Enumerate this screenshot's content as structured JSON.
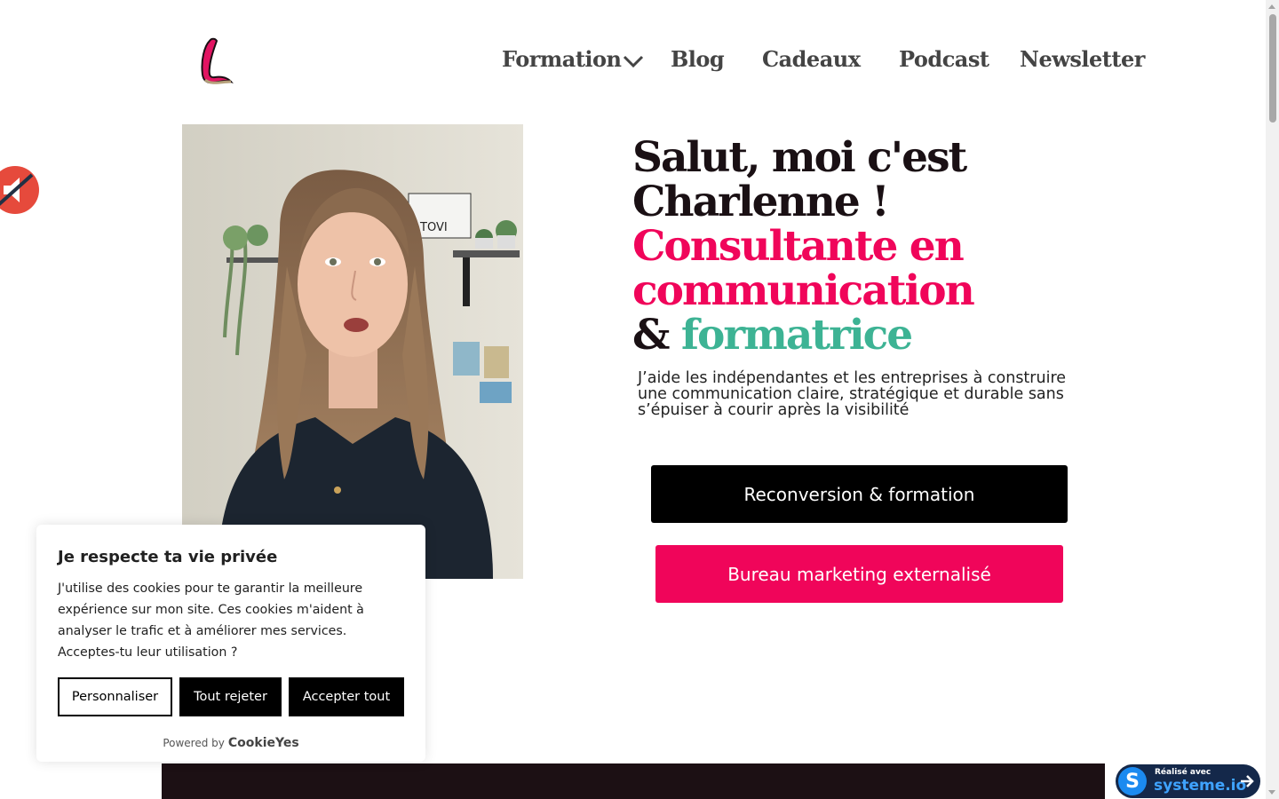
{
  "header": {
    "logo_icon": "script-letter-l-logo",
    "nav": [
      {
        "label": "Formation",
        "has_dropdown": true
      },
      {
        "label": "Blog"
      },
      {
        "label": "Cadeaux"
      },
      {
        "label": "Podcast"
      },
      {
        "label": "Newsletter"
      }
    ]
  },
  "hero": {
    "line1": "Salut, moi c'est",
    "line2": "Charlenne !",
    "line3": "Consultante en",
    "line4": "communication",
    "amp": "&",
    "highlight": "formatrice",
    "subtitle": "J’aide les indépendantes et les entreprises à construire une communication claire, stratégique et durable sans s’épuiser à courir après la visibilité",
    "btn_primary": "Reconversion & formation",
    "btn_secondary": "Bureau marketing externalisé",
    "video_icon": "muted-speaker-icon"
  },
  "cookie": {
    "title": "Je respecte ta vie privée",
    "text": "J'utilise des cookies pour te garantir la meilleure expérience sur mon site. Ces cookies m'aident à analyser le trafic et à améliorer mes services. Acceptes-tu leur utilisation ?",
    "btn_customize": "Personnaliser",
    "btn_reject": "Tout rejeter",
    "btn_accept": "Accepter tout",
    "powered_by": "Powered by",
    "powered_brand": "CookieYes"
  },
  "badge": {
    "small": "Réalisé avec",
    "big": "systeme.io",
    "letter": "S"
  },
  "colors": {
    "brand_pink": "#f0055a",
    "brand_teal": "#3db394",
    "dark": "#1c1014"
  }
}
